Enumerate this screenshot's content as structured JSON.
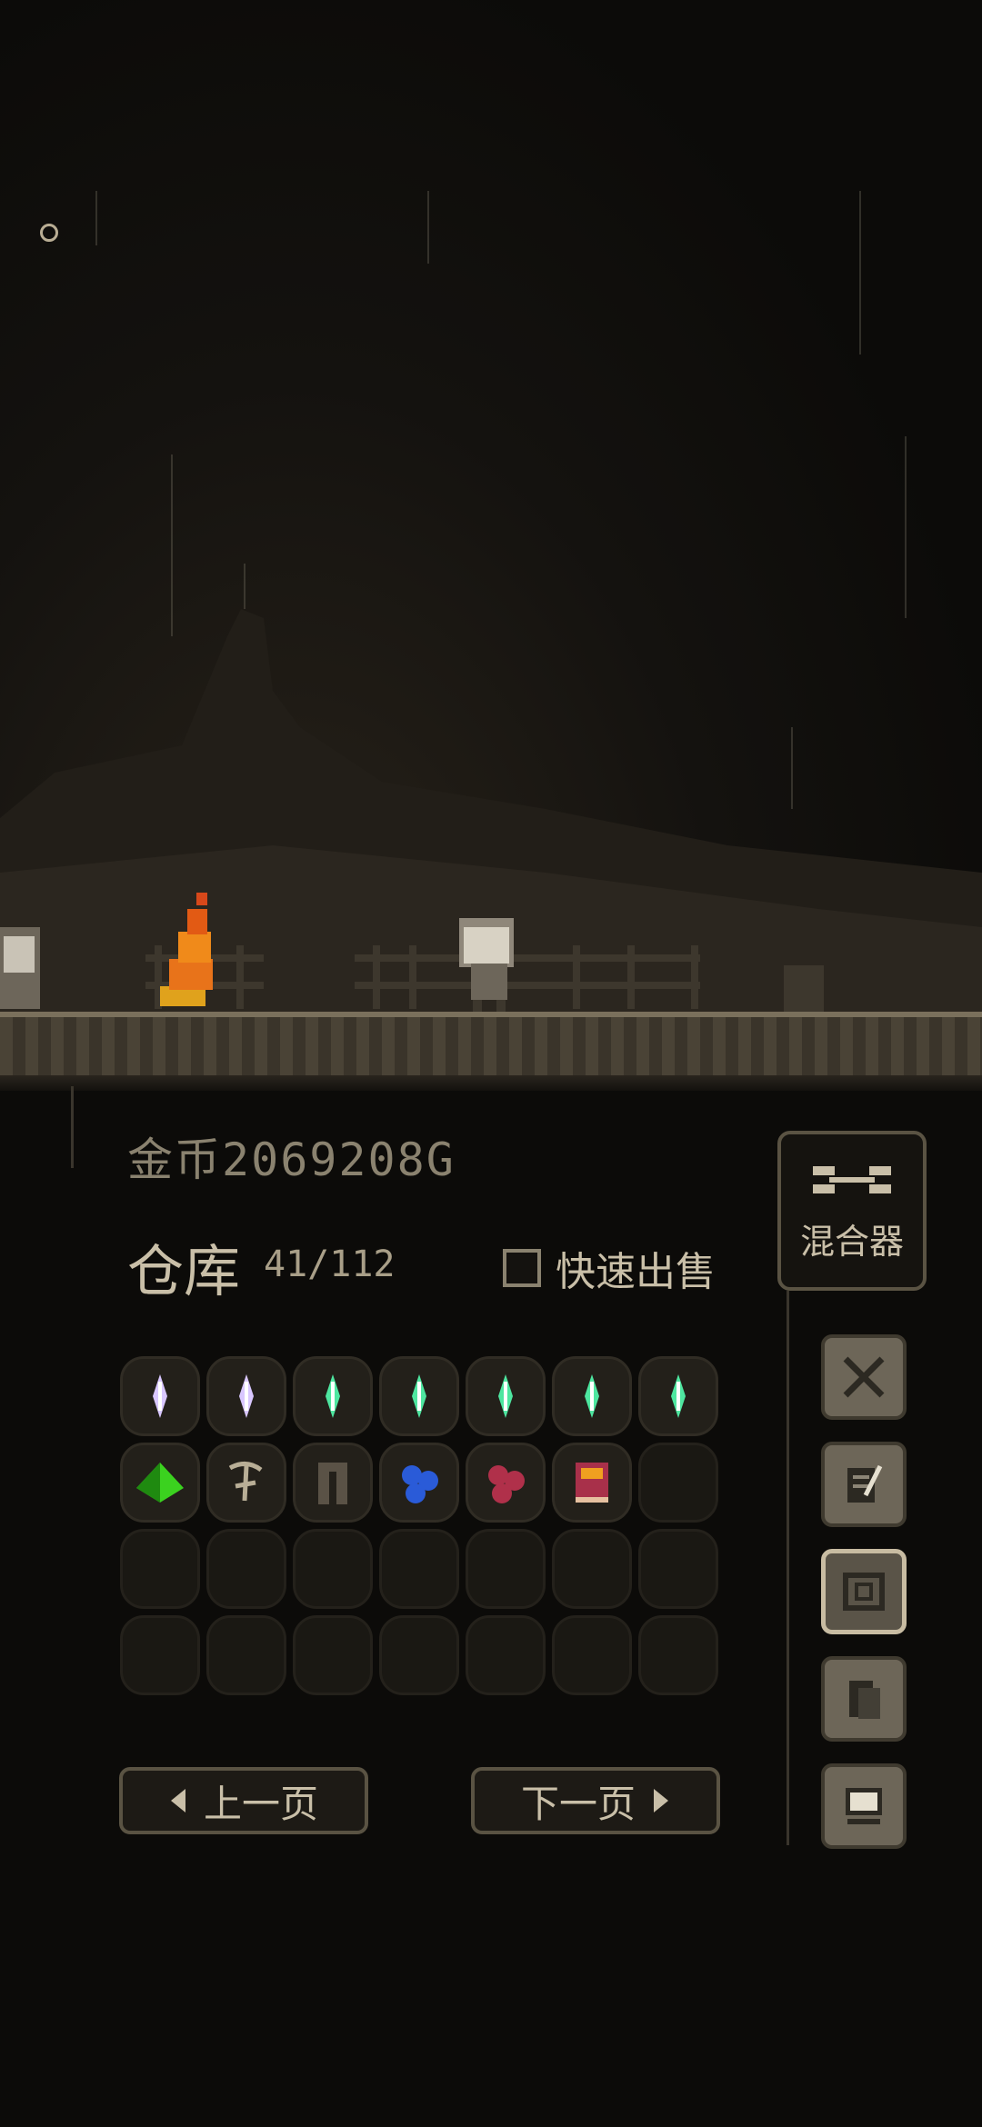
{
  "gold": {
    "label": "金币2069208G"
  },
  "storage": {
    "title": "仓库",
    "count": "41/112"
  },
  "quick_sell": {
    "label": "快速出售",
    "checked": false
  },
  "mixer": {
    "label": "混合器",
    "icon": "crossed-wrenches-icon"
  },
  "pagination": {
    "prev_label": "上一页",
    "next_label": "下一页"
  },
  "inventory": {
    "slots": [
      {
        "item": "purple-crystal",
        "color": "#d9c7ff"
      },
      {
        "item": "purple-crystal",
        "color": "#d9c7ff"
      },
      {
        "item": "green-crystal",
        "color": "#4ee6a0"
      },
      {
        "item": "green-crystal",
        "color": "#4ee6a0"
      },
      {
        "item": "green-crystal",
        "color": "#4ee6a0"
      },
      {
        "item": "green-crystal",
        "color": "#4ee6a0"
      },
      {
        "item": "green-crystal",
        "color": "#4ee6a0"
      },
      {
        "item": "green-pyramid",
        "color": "#3bd21f"
      },
      {
        "item": "bone-shard",
        "color": "#b8ae96"
      },
      {
        "item": "dark-pants",
        "color": "#5a5246"
      },
      {
        "item": "blue-berries",
        "color": "#2a5bd8"
      },
      {
        "item": "red-berries",
        "color": "#b0304a"
      },
      {
        "item": "red-book",
        "color": "#a8304a"
      },
      {
        "item": "empty"
      },
      {
        "item": "empty"
      },
      {
        "item": "empty"
      },
      {
        "item": "empty"
      },
      {
        "item": "empty"
      },
      {
        "item": "empty"
      },
      {
        "item": "empty"
      },
      {
        "item": "empty"
      },
      {
        "item": "empty"
      },
      {
        "item": "empty"
      },
      {
        "item": "empty"
      },
      {
        "item": "empty"
      },
      {
        "item": "empty"
      },
      {
        "item": "empty"
      },
      {
        "item": "empty"
      }
    ]
  },
  "side_tabs": [
    {
      "icon": "swords-icon",
      "active": false
    },
    {
      "icon": "scroll-icon",
      "active": false
    },
    {
      "icon": "storage-box-icon",
      "active": true
    },
    {
      "icon": "documents-icon",
      "active": false
    },
    {
      "icon": "computer-icon",
      "active": false
    }
  ],
  "colors": {
    "panel_border": "#5a5343",
    "text_primary": "#c9bfa8",
    "text_muted": "#8a826f",
    "fire": "#f08a1a"
  }
}
